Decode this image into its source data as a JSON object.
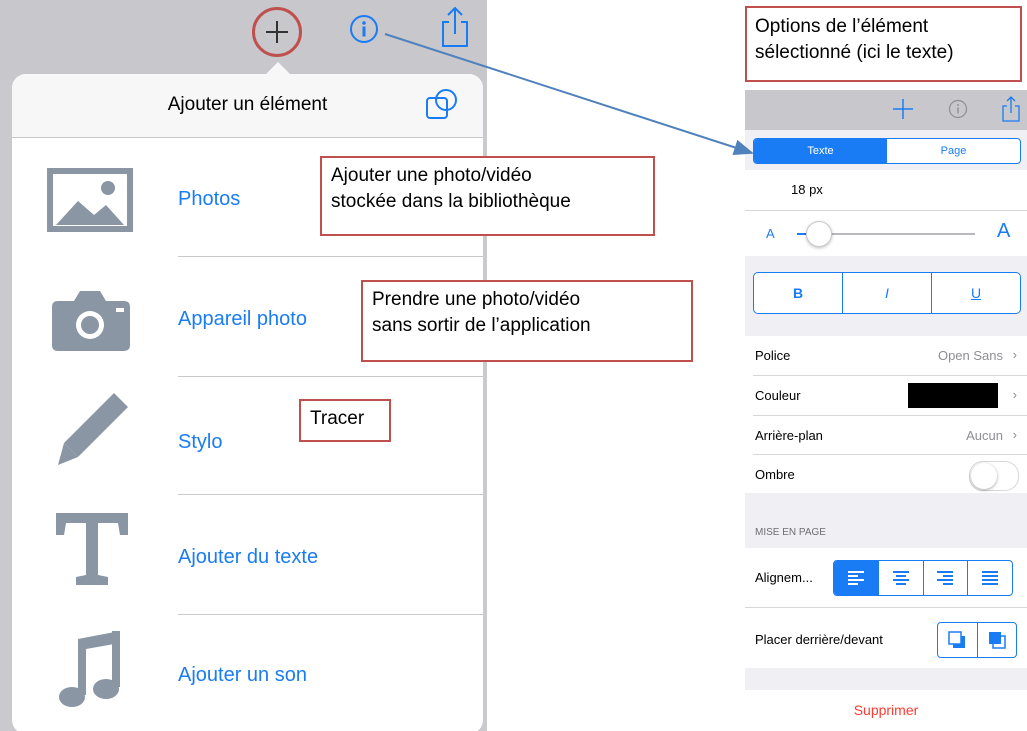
{
  "left": {
    "popover_title": "Ajouter un élément",
    "items": [
      {
        "label": "Photos",
        "icon": "photo-icon"
      },
      {
        "label": "Appareil photo",
        "icon": "camera-icon"
      },
      {
        "label": "Stylo",
        "icon": "pencil-icon"
      },
      {
        "label": "Ajouter du texte",
        "icon": "text-t-icon"
      },
      {
        "label": "Ajouter un son",
        "icon": "music-note-icon"
      }
    ]
  },
  "callouts": {
    "photos_line1": "Ajouter une photo/vidéo",
    "photos_line2": "stockée dans la bibliothèque",
    "camera_line1": "Prendre une photo/vidéo",
    "camera_line2": "sans sortir de l’application",
    "stylo": "Tracer",
    "options_line1": "Options de l’élément",
    "options_line2": "sélectionné (ici le texte)"
  },
  "right": {
    "tabs": {
      "texte": "Texte",
      "page": "Page"
    },
    "font_size": "18 px",
    "slider_small": "A",
    "slider_large": "A",
    "slider_value": 0.12,
    "style_buttons": {
      "bold": "B",
      "italic": "I",
      "underline": "U"
    },
    "rows": {
      "police_label": "Police",
      "police_value": "Open Sans",
      "couleur_label": "Couleur",
      "arriere_label": "Arrière-plan",
      "arriere_value": "Aucun",
      "ombre_label": "Ombre"
    },
    "section_header": "MISE EN PAGE",
    "alignment_label": "Alignem...",
    "order_label": "Placer derrière/devant",
    "delete_label": "Supprimer"
  },
  "colors": {
    "accent": "#1a7cf5",
    "callout_border": "#c0504d",
    "arrow": "#4f81bd",
    "icon_gray": "#8a96a3",
    "delete_red": "#ff3b30",
    "couleur_swatch": "#000000"
  }
}
